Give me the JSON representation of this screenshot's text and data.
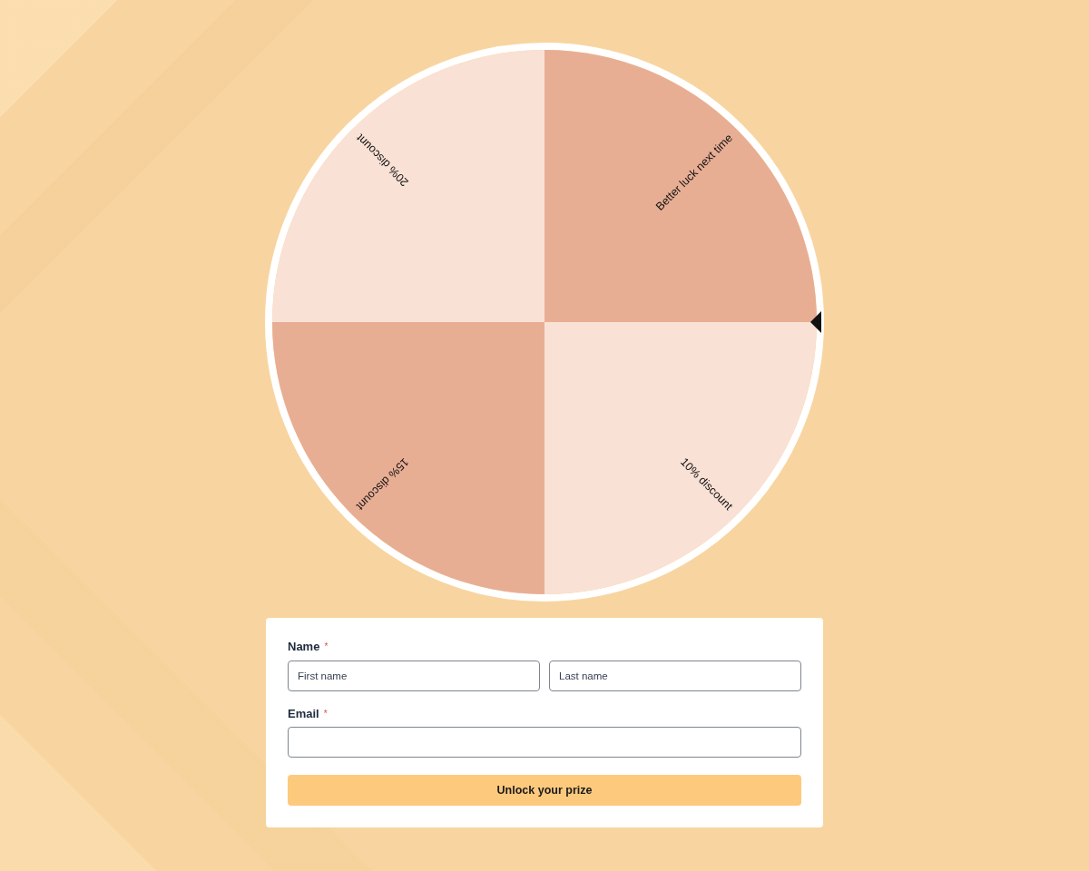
{
  "wheel": {
    "segments": [
      {
        "label": "Better luck next time",
        "color": "#e8ae94"
      },
      {
        "label": "10% discount",
        "color": "#f9e1d5"
      },
      {
        "label": "15% discount",
        "color": "#e8ae94"
      },
      {
        "label": "20% discount",
        "color": "#f9e1d5"
      }
    ]
  },
  "form": {
    "fields": [
      {
        "label": "Name",
        "required_mark": "*",
        "inputs": [
          {
            "kind": "text",
            "placeholder": "First name"
          },
          {
            "kind": "text",
            "placeholder": "Last name"
          }
        ]
      },
      {
        "label": "Email",
        "required_mark": "*",
        "inputs": [
          {
            "kind": "text"
          }
        ]
      }
    ],
    "submit_button": {
      "label": "Unlock your prize"
    }
  }
}
